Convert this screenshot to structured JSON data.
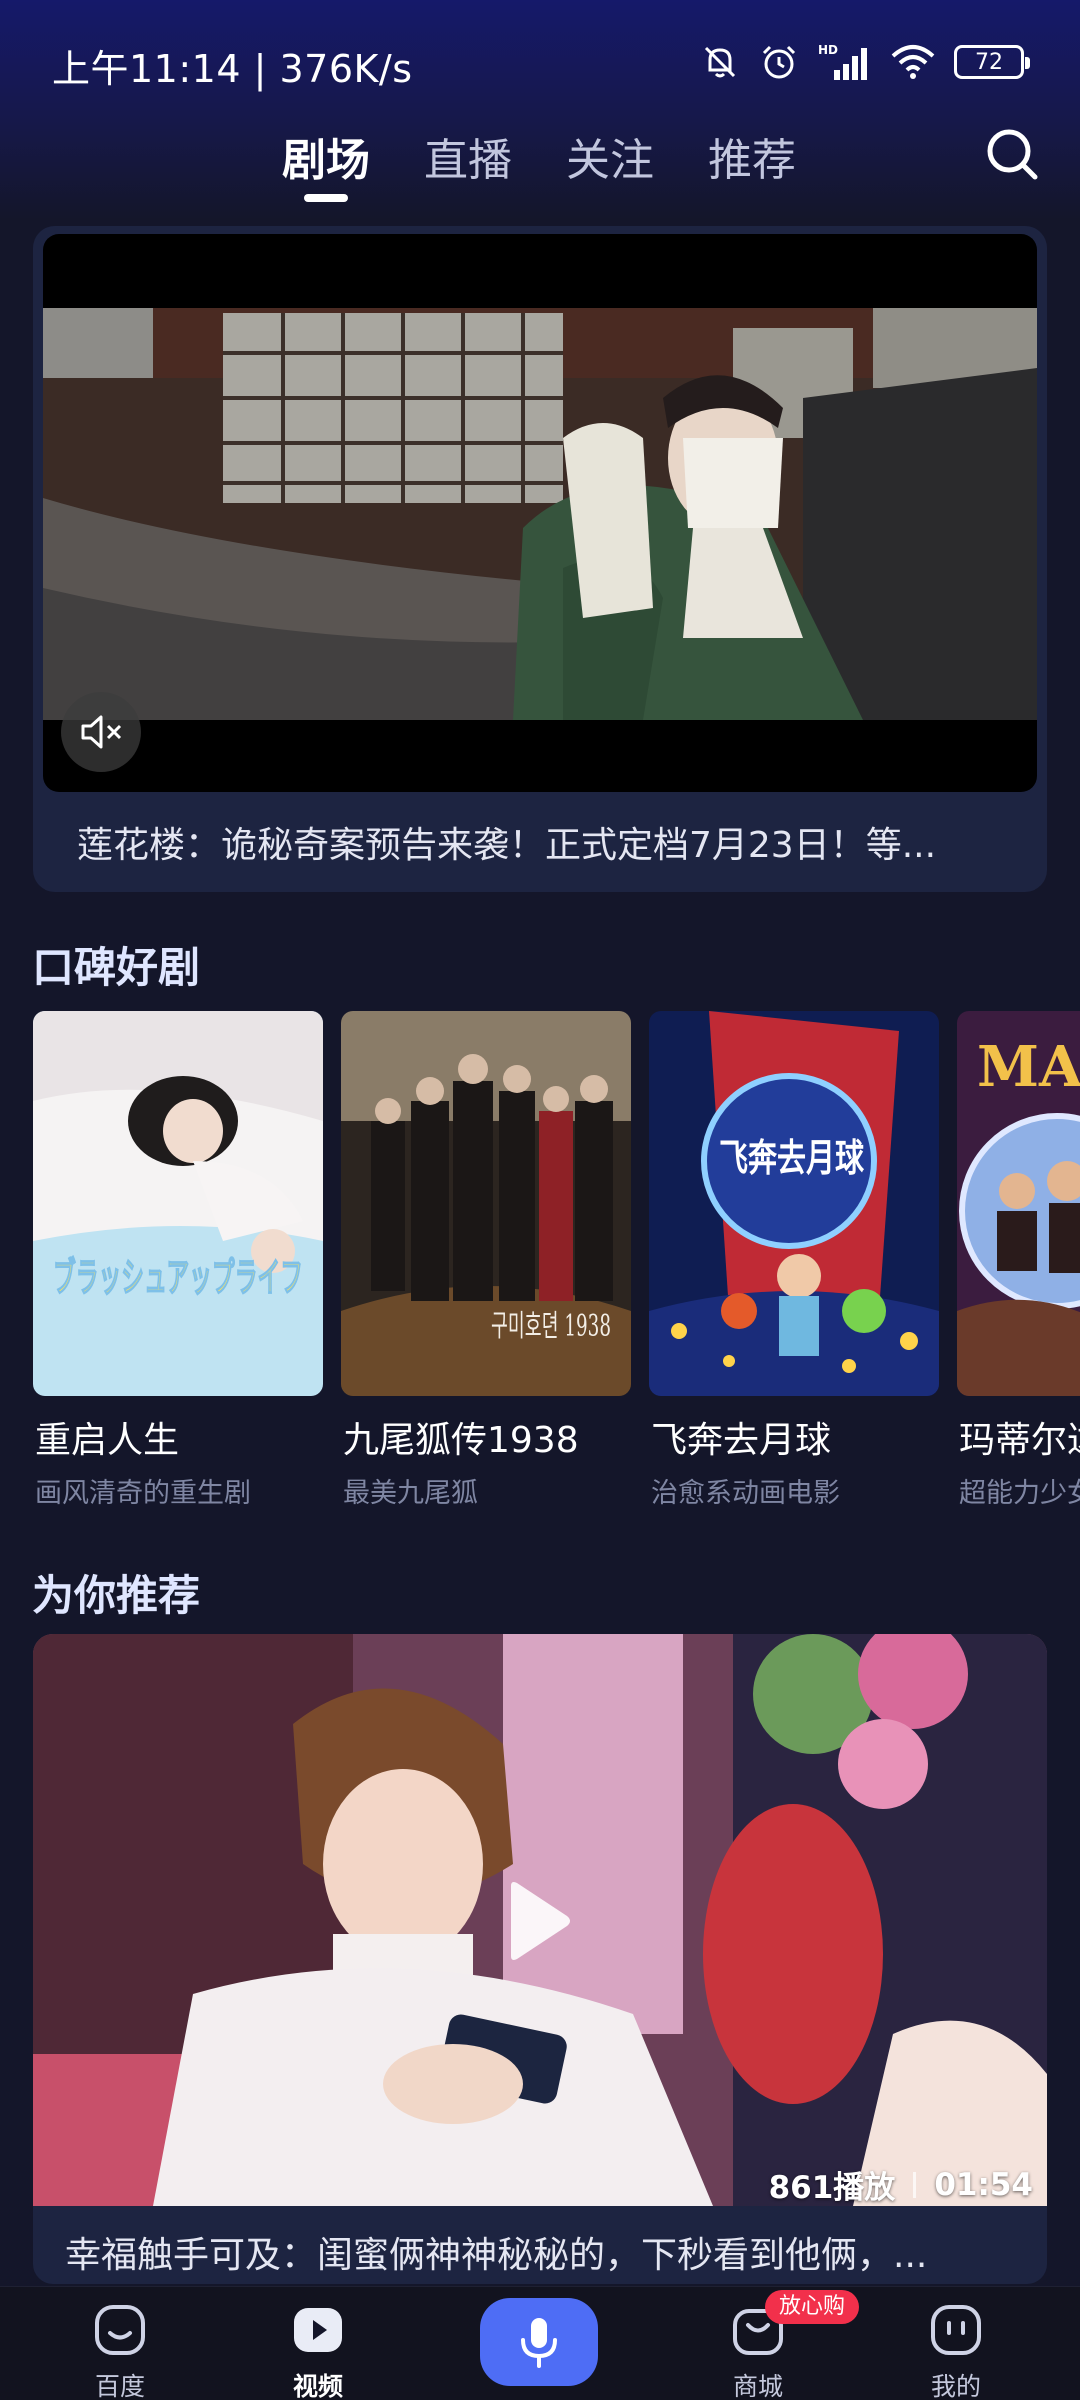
{
  "status_bar": {
    "time": "上午11:14 | 376K/s",
    "battery": "72",
    "network_label": "HD"
  },
  "top_tabs": [
    {
      "label": "剧场",
      "active": true
    },
    {
      "label": "直播",
      "active": false
    },
    {
      "label": "关注",
      "active": false
    },
    {
      "label": "推荐",
      "active": false
    }
  ],
  "featured": {
    "caption": "莲花楼：诡秘奇案预告来袭！正式定档7月23日！等..."
  },
  "section_dramas": {
    "title": "口碑好剧",
    "items": [
      {
        "title": "重启人生",
        "subtitle": "画风清奇的重生剧",
        "poster_text": "ブラッシュアップライフ"
      },
      {
        "title": "九尾狐传1938",
        "subtitle": "最美九尾狐",
        "poster_text": "구미호뎐 1938"
      },
      {
        "title": "飞奔去月球",
        "subtitle": "治愈系动画电影",
        "poster_text": "飞奔去月球"
      },
      {
        "title": "玛蒂尔达",
        "subtitle": "超能力少女",
        "poster_text": "MATILDA"
      }
    ]
  },
  "section_recommend": {
    "title": "为你推荐",
    "plays": "861播放",
    "duration": "01:54",
    "caption": "幸福触手可及：闺蜜俩神神秘秘的，下秒看到他俩，..."
  },
  "bottom_nav": [
    {
      "label": "百度",
      "icon": "baidu-icon",
      "active": false
    },
    {
      "label": "视频",
      "icon": "video-icon",
      "active": true
    },
    {
      "label": "",
      "icon": "mic-icon",
      "active": false
    },
    {
      "label": "商城",
      "icon": "shop-icon",
      "active": false
    },
    {
      "label": "我的",
      "icon": "profile-icon",
      "active": false
    }
  ],
  "shop_badge": "放心购",
  "colors": {
    "background": "#14162a",
    "accent": "#4e6df5",
    "badge": "#f2304b"
  }
}
